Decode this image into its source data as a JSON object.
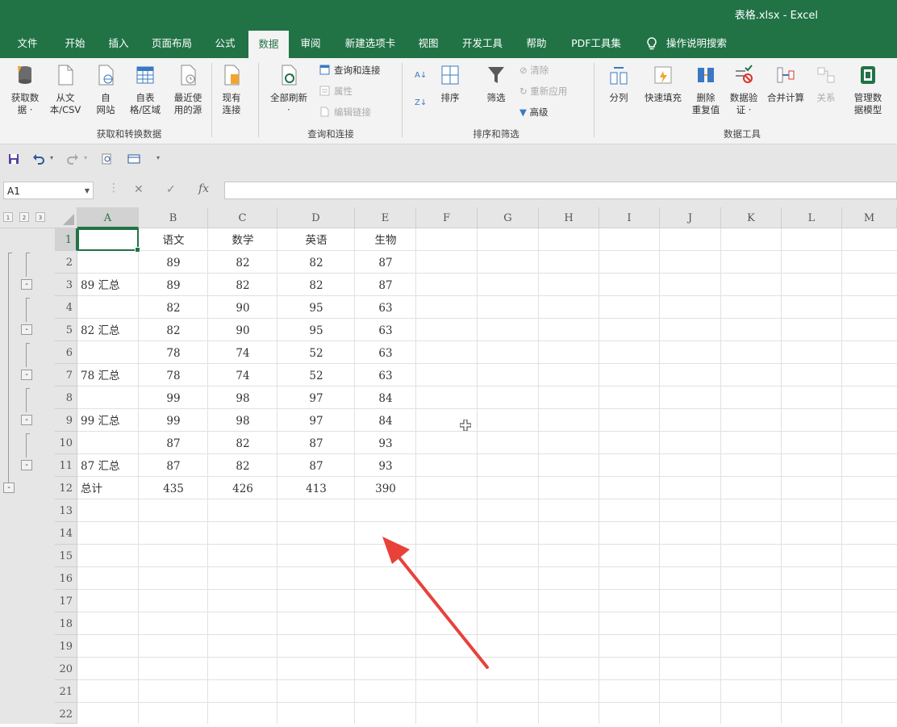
{
  "window": {
    "title": "表格.xlsx - Excel"
  },
  "tabs": [
    "文件",
    "开始",
    "插入",
    "页面布局",
    "公式",
    "数据",
    "审阅",
    "新建选项卡",
    "视图",
    "开发工具",
    "帮助",
    "PDF工具集",
    "操作说明搜索"
  ],
  "active_tab": "数据",
  "ribbon": {
    "get_data": [
      "获取数",
      "据 ·"
    ],
    "from_text": [
      "从文",
      "本/CSV"
    ],
    "from_web": [
      "自",
      "网站"
    ],
    "from_table": [
      "自表",
      "格/区域"
    ],
    "recent": [
      "最近使",
      "用的源"
    ],
    "existing": [
      "现有",
      "连接"
    ],
    "group1": "获取和转换数据",
    "refresh_all": [
      "全部刷新",
      "·"
    ],
    "queries": "查询和连接",
    "properties": "属性",
    "edit_links": "编辑链接",
    "group2": "查询和连接",
    "sort": "排序",
    "filter": "筛选",
    "clear": "清除",
    "reapply": "重新应用",
    "advanced": "高级",
    "group3": "排序和筛选",
    "text_to_col": "分列",
    "flash_fill": "快速填充",
    "remove_dup": [
      "删除",
      "重复值"
    ],
    "validation": [
      "数据验",
      "证 ·"
    ],
    "consolidate": "合并计算",
    "relations": "关系",
    "data_model": [
      "管理数",
      "据模型"
    ],
    "group4": "数据工具"
  },
  "formula_bar": {
    "name_box": "A1",
    "fx": "fx",
    "value": ""
  },
  "outline_levels": [
    "1",
    "2",
    "3"
  ],
  "columns": [
    "A",
    "B",
    "C",
    "D",
    "E",
    "F",
    "G",
    "H",
    "I",
    "J",
    "K",
    "L",
    "M"
  ],
  "rows": [
    "1",
    "2",
    "3",
    "4",
    "5",
    "6",
    "7",
    "8",
    "9",
    "10",
    "11",
    "12",
    "13",
    "14",
    "15",
    "16",
    "17",
    "18",
    "19",
    "20",
    "21",
    "22"
  ],
  "table": [
    [
      "",
      "语文",
      "数学",
      "英语",
      "生物"
    ],
    [
      "",
      "89",
      "82",
      "82",
      "87"
    ],
    [
      "89 汇总",
      "89",
      "82",
      "82",
      "87"
    ],
    [
      "",
      "82",
      "90",
      "95",
      "63"
    ],
    [
      "82 汇总",
      "82",
      "90",
      "95",
      "63"
    ],
    [
      "",
      "78",
      "74",
      "52",
      "63"
    ],
    [
      "78 汇总",
      "78",
      "74",
      "52",
      "63"
    ],
    [
      "",
      "99",
      "98",
      "97",
      "84"
    ],
    [
      "99 汇总",
      "99",
      "98",
      "97",
      "84"
    ],
    [
      "",
      "87",
      "82",
      "87",
      "93"
    ],
    [
      "87 汇总",
      "87",
      "82",
      "87",
      "93"
    ],
    [
      "总计",
      "435",
      "426",
      "413",
      "390"
    ]
  ],
  "colors": {
    "excel_green": "#217346",
    "annotation_arrow": "#e8413a"
  }
}
